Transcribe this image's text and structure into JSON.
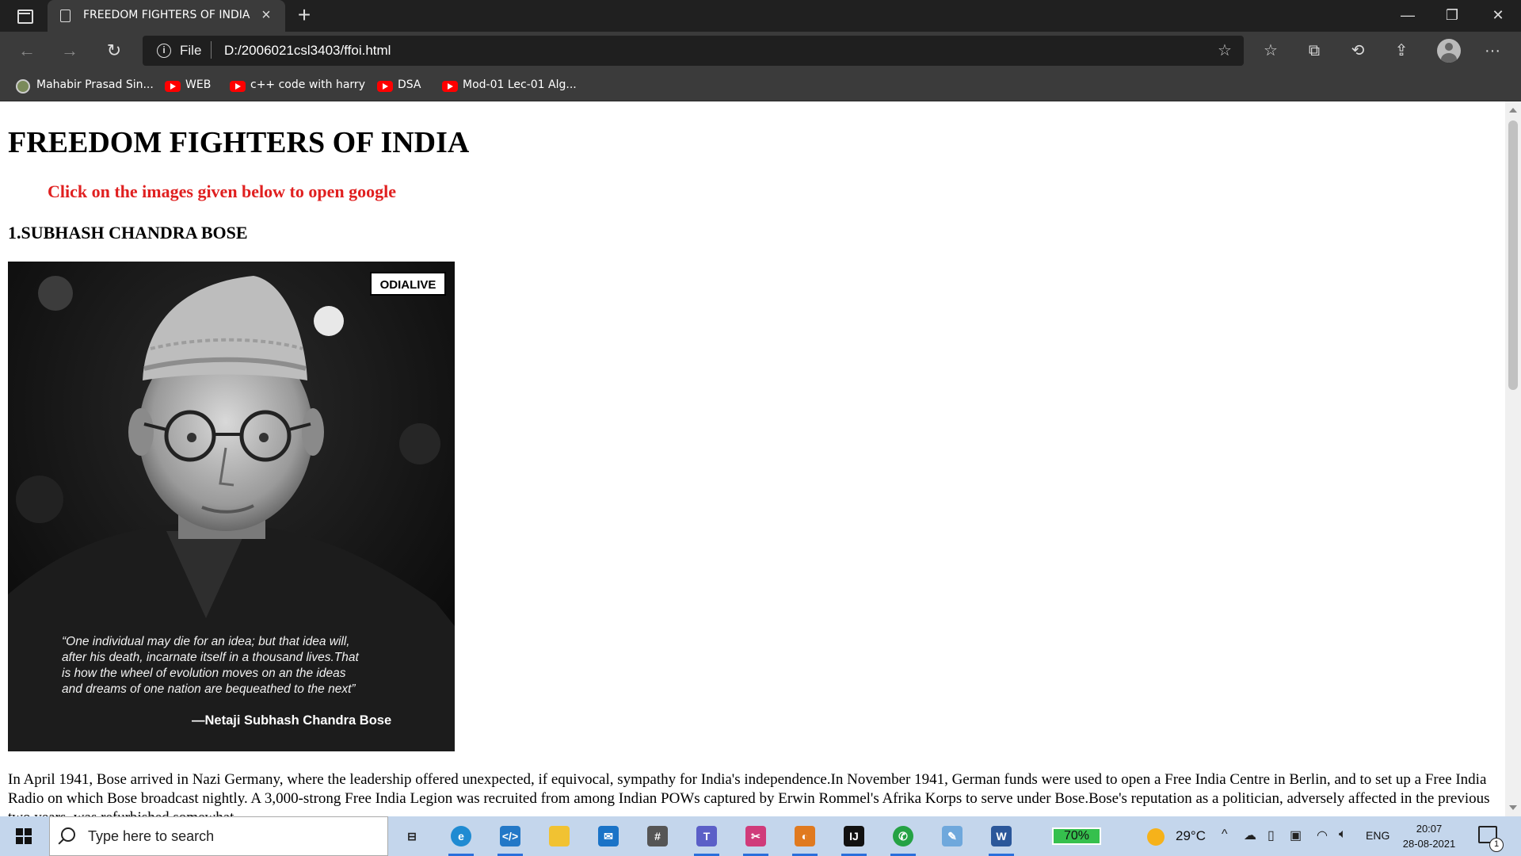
{
  "browser": {
    "tab_title": "FREEDOM FIGHTERS OF INDIA",
    "address_scheme": "File",
    "address_url": "D:/2006021csl3403/ffoi.html",
    "bookmarks": [
      {
        "label": "Mahabir Prasad Sin...",
        "icon": "generic-site-icon"
      },
      {
        "label": "WEB",
        "icon": "youtube-icon"
      },
      {
        "label": "c++ code with harry",
        "icon": "youtube-icon"
      },
      {
        "label": "DSA",
        "icon": "youtube-icon"
      },
      {
        "label": "Mod-01 Lec-01 Alg...",
        "icon": "youtube-icon"
      }
    ]
  },
  "page": {
    "heading": "FREEDOM FIGHTERS OF INDIA",
    "instruction": "Click on the images given below to open google",
    "section1_title": "1.SUBHASH CHANDRA BOSE",
    "image": {
      "logo_text": "ODIALIVE",
      "quote_lines": [
        "“One individual may die for an idea; but that idea will,",
        "after his death, incarnate itself in a thousand lives.That",
        "is how the wheel of evolution moves on an the ideas",
        "and dreams of one nation are bequeathed to the next”"
      ],
      "attribution": "—Netaji Subhash Chandra Bose"
    },
    "paragraph": "In April 1941, Bose arrived in Nazi Germany, where the leadership offered unexpected, if equivocal, sympathy for India's independence.In November 1941, German funds were used to open a Free India Centre in Berlin, and to set up a Free India Radio on which Bose broadcast nightly. A 3,000-strong Free India Legion was recruited from among Indian POWs captured by Erwin Rommel's Afrika Korps to serve under Bose.Bose's reputation as a politician, adversely affected in the previous two years, was refurbished somewhat."
  },
  "taskbar": {
    "search_placeholder": "Type here to search",
    "battery": "70%",
    "temperature": "29°C",
    "language": "ENG",
    "time": "20:07",
    "date": "28-08-2021",
    "notification_count": "1"
  },
  "colors": {
    "instruction_red": "#e02020",
    "titlebar": "#202020",
    "toolbar": "#3b3b3b",
    "taskbar": "#c4d6ec"
  }
}
